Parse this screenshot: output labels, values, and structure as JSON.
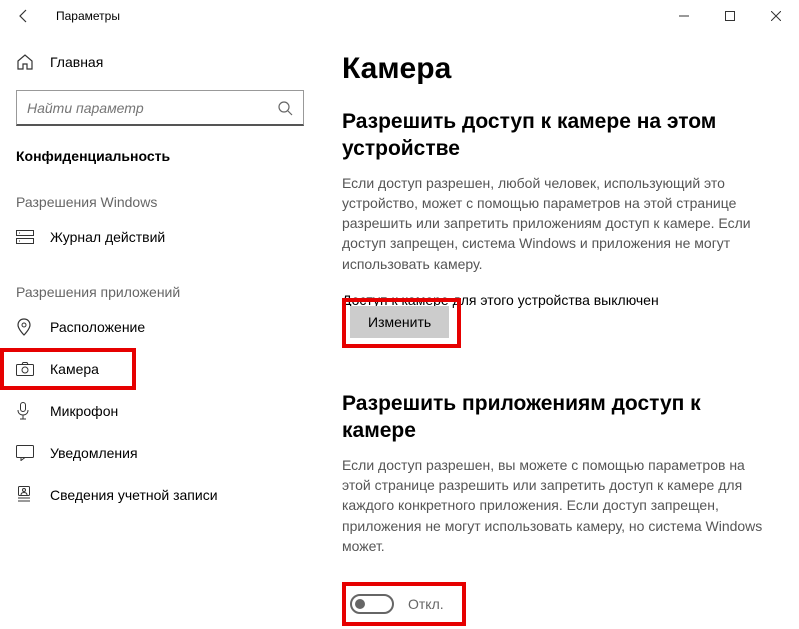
{
  "titlebar": {
    "title": "Параметры"
  },
  "sidebar": {
    "home_label": "Главная",
    "search_placeholder": "Найти параметр",
    "section_privacy": "Конфиденциальность",
    "subhead_windows": "Разрешения Windows",
    "subhead_apps": "Разрешения приложений",
    "items_windows": [
      {
        "label": "Журнал действий"
      }
    ],
    "items_apps": [
      {
        "label": "Расположение"
      },
      {
        "label": "Камера"
      },
      {
        "label": "Микрофон"
      },
      {
        "label": "Уведомления"
      },
      {
        "label": "Сведения учетной записи"
      }
    ]
  },
  "main": {
    "page_title": "Камера",
    "sec1_heading": "Разрешить доступ к камере на этом устройстве",
    "sec1_desc": "Если доступ разрешен, любой человек, использующий это устройство, может с помощью параметров на этой странице разрешить или запретить приложениям доступ к камере. Если доступ запрещен, система Windows и приложения не могут использовать камеру.",
    "sec1_status": "Доступ к камере для этого устройства выключен",
    "change_button": "Изменить",
    "sec2_heading": "Разрешить приложениям доступ к камере",
    "sec2_desc": "Если доступ разрешен, вы можете с помощью параметров на этой странице разрешить или запретить доступ к камере для каждого конкретного приложения. Если доступ запрещен, приложения не могут использовать камеру, но система Windows может.",
    "toggle_off_label": "Откл."
  }
}
